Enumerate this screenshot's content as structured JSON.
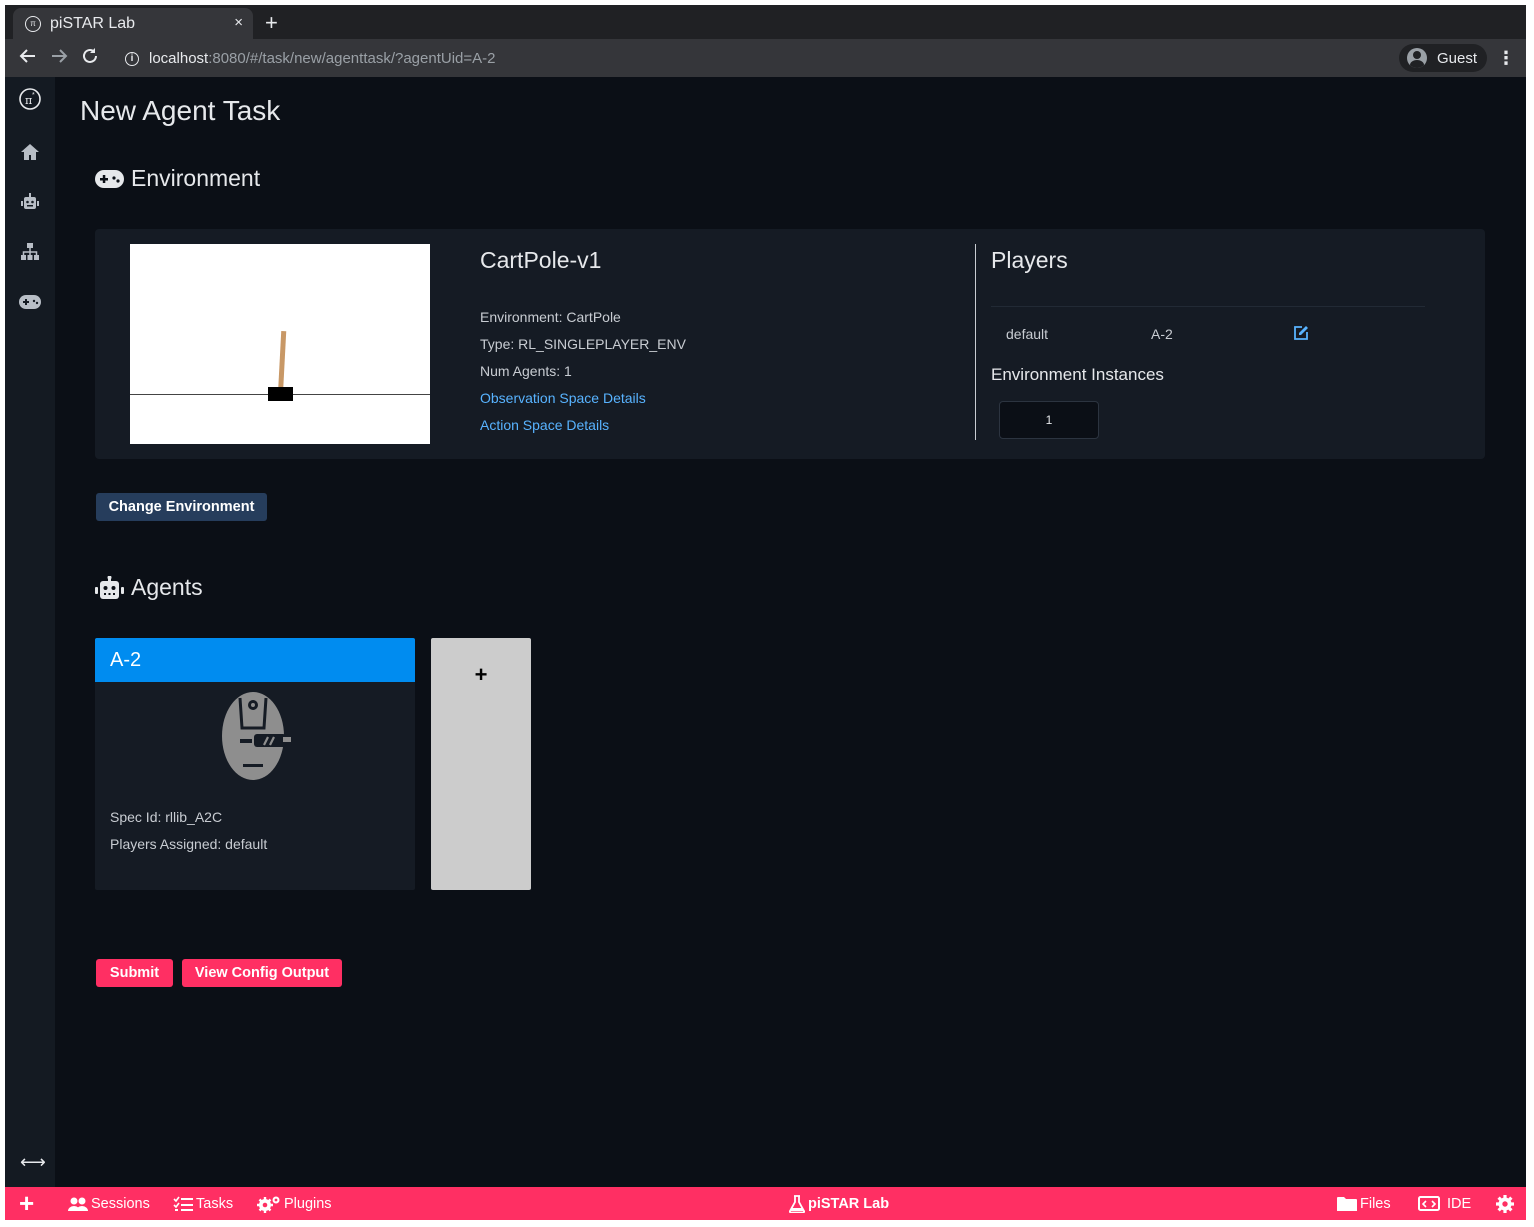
{
  "browser": {
    "tab_title": "piSTAR Lab",
    "tab_close": "×",
    "new_tab": "+",
    "url_host": "localhost",
    "url_path": ":8080/#/task/new/agenttask/?agentUid=A-2",
    "profile_name": "Guest"
  },
  "page": {
    "title": "New Agent Task"
  },
  "environment": {
    "section_title": "Environment",
    "name": "CartPole-v1",
    "info": {
      "environment": "Environment: CartPole",
      "type": "Type: RL_SINGLEPLAYER_ENV",
      "num_agents": "Num Agents: 1"
    },
    "links": {
      "observation": "Observation Space Details",
      "action": "Action Space Details"
    },
    "players_title": "Players",
    "player": {
      "name": "default",
      "agent": "A-2"
    },
    "instances_title": "Environment Instances",
    "instances_value": "1",
    "change_button": "Change Environment"
  },
  "agents": {
    "section_title": "Agents",
    "card": {
      "title": "A-2",
      "spec": "Spec Id: rllib_A2C",
      "players": "Players Assigned: default"
    },
    "add_label": "+"
  },
  "actions": {
    "submit": "Submit",
    "view_config": "View Config Output"
  },
  "footer": {
    "add": "+",
    "sessions": "Sessions",
    "tasks": "Tasks",
    "plugins": "Plugins",
    "brand": "piSTAR Lab",
    "files": "Files",
    "ide": "IDE"
  },
  "colors": {
    "accent_pink": "#ff2f63",
    "agent_blue": "#008cf0",
    "link_blue": "#58b3ff",
    "navy_button": "#263d5c",
    "background": "#0b0f16"
  },
  "icons": [
    "pistar-logo-icon",
    "home-icon",
    "robot-icon",
    "sitemap-icon",
    "gamepad-icon",
    "expand-arrows-icon",
    "edit-icon",
    "flask-icon",
    "users-icon",
    "tasks-icon",
    "cogs-icon",
    "folder-icon",
    "code-icon",
    "gear-icon"
  ]
}
